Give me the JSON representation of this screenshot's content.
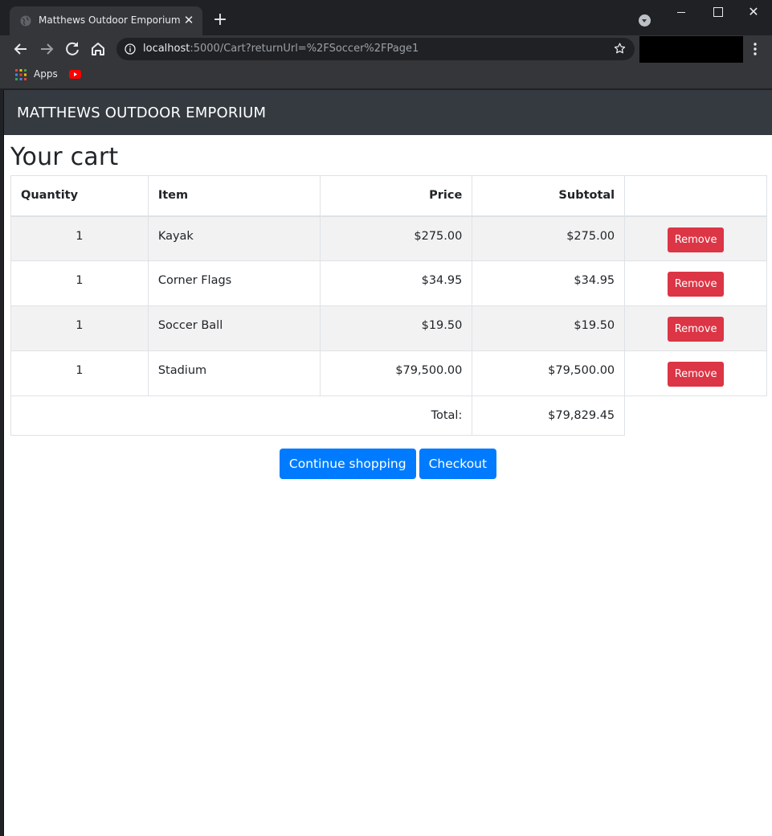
{
  "browser": {
    "tab_title": "Matthews Outdoor Emporium",
    "url_host": "localhost",
    "url_rest": ":5000/Cart?returnUrl=%2FSoccer%2FPage1",
    "bookmarks": [
      {
        "label": "Apps"
      }
    ]
  },
  "navbar": {
    "brand": "MATTHEWS OUTDOOR EMPORIUM"
  },
  "page": {
    "title": "Your cart",
    "table": {
      "headers": {
        "quantity": "Quantity",
        "item": "Item",
        "price": "Price",
        "subtotal": "Subtotal"
      },
      "rows": [
        {
          "quantity": "1",
          "item": "Kayak",
          "price": "$275.00",
          "subtotal": "$275.00",
          "action": "Remove"
        },
        {
          "quantity": "1",
          "item": "Corner Flags",
          "price": "$34.95",
          "subtotal": "$34.95",
          "action": "Remove"
        },
        {
          "quantity": "1",
          "item": "Soccer Ball",
          "price": "$19.50",
          "subtotal": "$19.50",
          "action": "Remove"
        },
        {
          "quantity": "1",
          "item": "Stadium",
          "price": "$79,500.00",
          "subtotal": "$79,500.00",
          "action": "Remove"
        }
      ],
      "total_label": "Total:",
      "total_value": "$79,829.45"
    },
    "buttons": {
      "continue": "Continue shopping",
      "checkout": "Checkout"
    }
  },
  "colors": {
    "navbar": "#343a40",
    "remove": "#dc3545",
    "primary": "#007bff",
    "stripe": "#f2f2f2"
  }
}
